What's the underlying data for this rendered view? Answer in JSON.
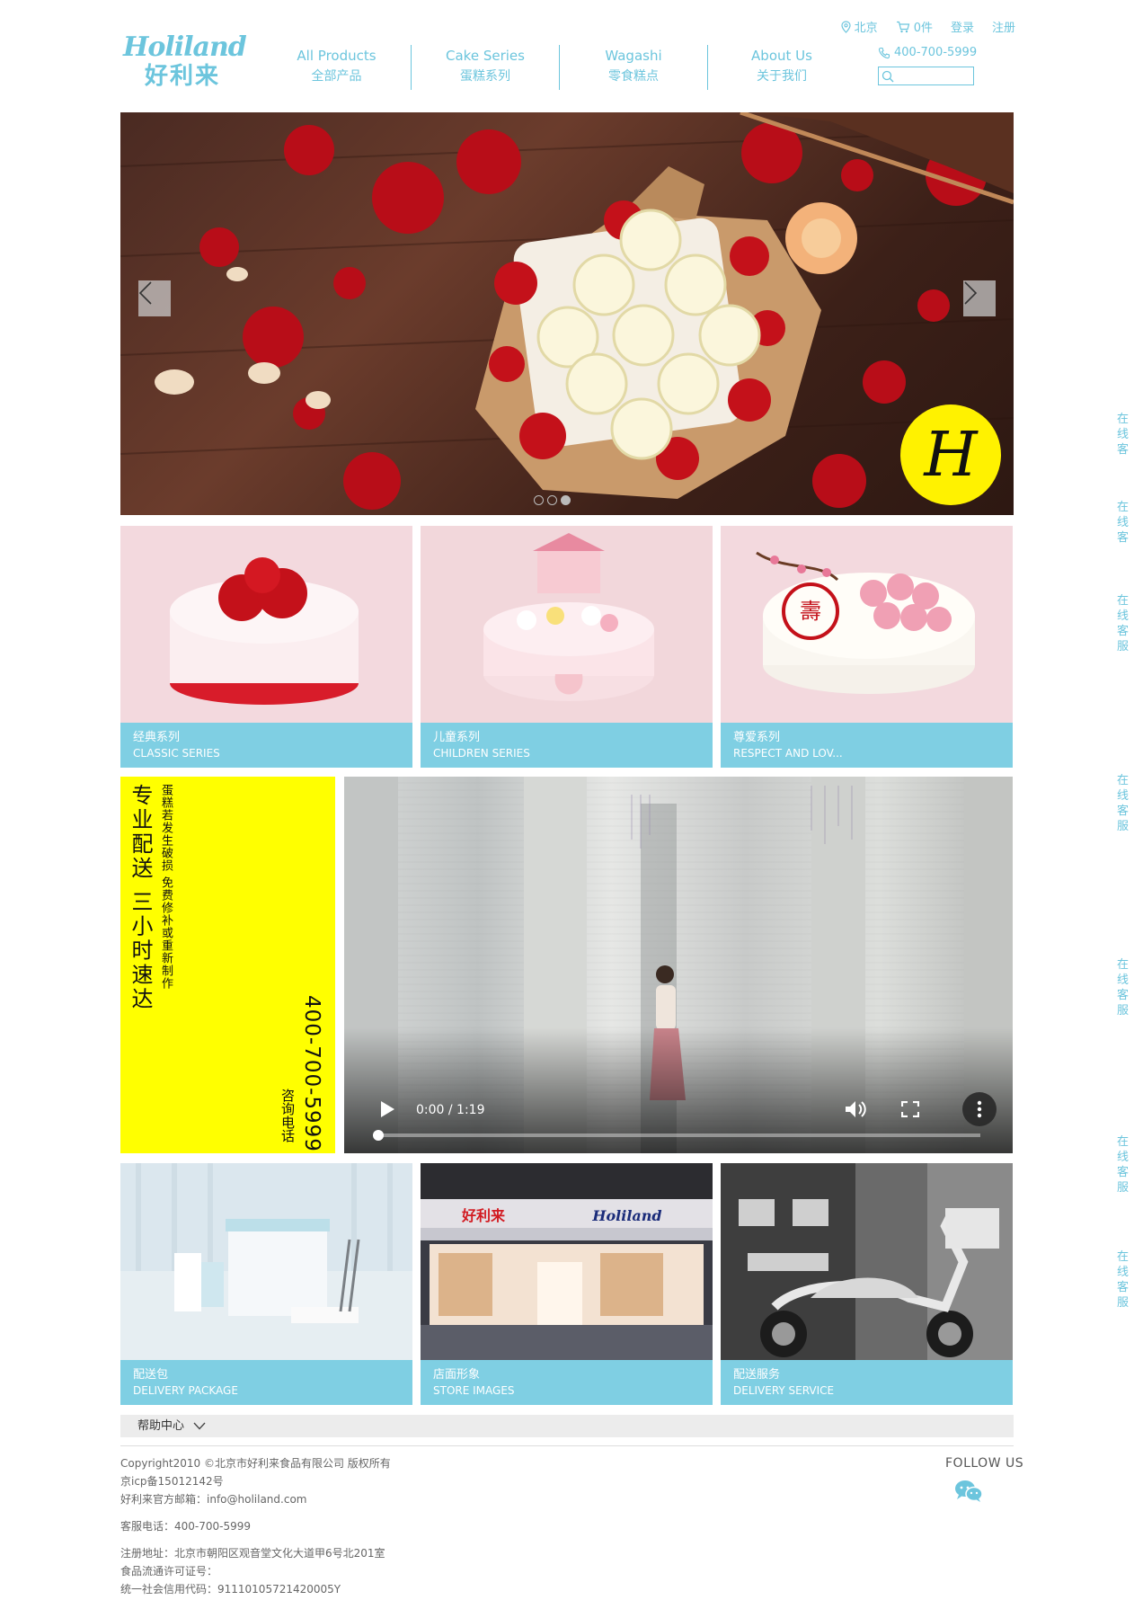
{
  "brand": {
    "name_en": "Holiland",
    "name_cn": "好利来"
  },
  "nav": [
    {
      "en": "All Products",
      "cn": "全部产品"
    },
    {
      "en": "Cake Series",
      "cn": "蛋糕系列"
    },
    {
      "en": "Wagashi",
      "cn": "零食糕点"
    },
    {
      "en": "About Us",
      "cn": "关于我们"
    }
  ],
  "top_links": {
    "city": "北京",
    "cart": "0件",
    "login": "登录",
    "register": "注册"
  },
  "phone": "400-700-5999",
  "search": {
    "placeholder": ""
  },
  "slider": {
    "badge_letter": "H",
    "dots": 3,
    "active_dot": 2
  },
  "cards": [
    {
      "cn": "经典系列",
      "en": "CLASSIC SERIES"
    },
    {
      "cn": "儿童系列",
      "en": "CHILDREN SERIES"
    },
    {
      "cn": "尊爱系列",
      "en": "RESPECT AND LOV..."
    }
  ],
  "delivery": {
    "headline": "专业配送 三小时速达",
    "detail": "蛋糕若发生破损 免费修补或重新制作",
    "phone": "400-700-5999",
    "phone_label": "咨询电话"
  },
  "video": {
    "time": "0:00 / 1:19",
    "progress": 0.0
  },
  "bottom_cards": [
    {
      "cn": "配送包",
      "en": "DELIVERY PACKAGE"
    },
    {
      "cn": "店面形象",
      "en": "STORE IMAGES"
    },
    {
      "cn": "配送服务",
      "en": "DELIVERY SERVICE"
    }
  ],
  "help": {
    "label": "帮助中心"
  },
  "footer": {
    "copyright": "Copyright2010 ©北京市好利来食品有限公司 版权所有",
    "icp": "京icp备15012142号",
    "email": "好利来官方邮箱：info@holiland.com",
    "service_phone": "客服电话：400-700-5999",
    "address": "注册地址：北京市朝阳区观音堂文化大道甲6号北201室",
    "license": "食品流通许可证号：",
    "credit_code": "统一社会信用代码：91110105721420005Y",
    "follow": "FOLLOW US"
  },
  "side_service": [
    {
      "label": "在线客"
    },
    {
      "label": "在线客"
    },
    {
      "label": "在线客服"
    },
    {
      "label": "在线客服"
    },
    {
      "label": "在线客服"
    },
    {
      "label": "在线客服"
    },
    {
      "label": "在线客服"
    }
  ],
  "colors": {
    "accent": "#6cc5dd",
    "caption_bg": "#7fcfe3",
    "yellow": "#ffff00",
    "help_bg": "#ececec"
  }
}
